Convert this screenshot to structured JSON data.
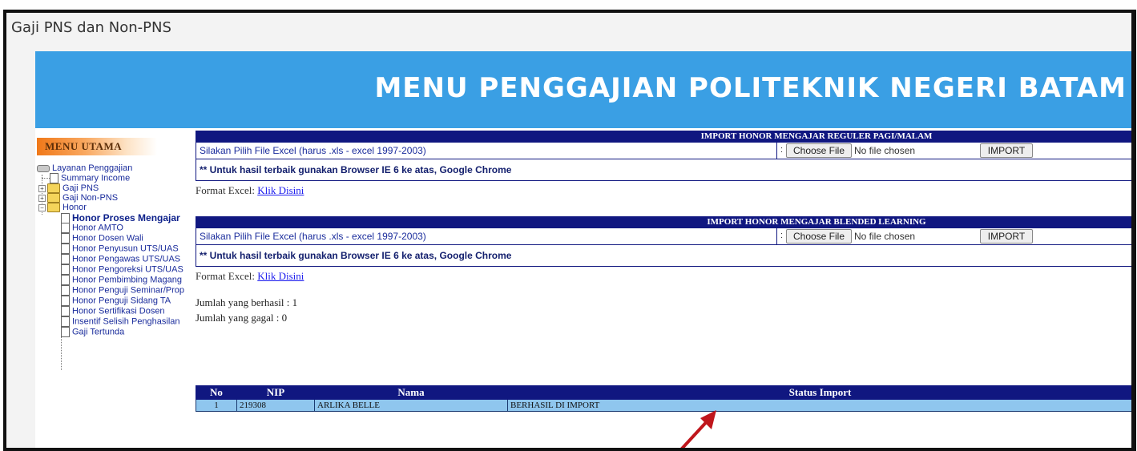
{
  "window": {
    "title": "Gaji PNS dan Non-PNS"
  },
  "banner": {
    "title": "MENU PENGGAJIAN POLITEKNIK NEGERI BATAM"
  },
  "sidebar": {
    "header": "MENU UTAMA",
    "items": [
      {
        "label": "Layanan Penggajian"
      },
      {
        "label": "Summary Income"
      },
      {
        "label": "Gaji PNS"
      },
      {
        "label": "Gaji Non-PNS"
      },
      {
        "label": "Honor"
      },
      {
        "label": "Honor Proses Mengajar"
      },
      {
        "label": "Honor AMTO"
      },
      {
        "label": "Honor Dosen Wali"
      },
      {
        "label": "Honor Penyusun UTS/UAS"
      },
      {
        "label": "Honor Pengawas UTS/UAS"
      },
      {
        "label": "Honor Pengoreksi UTS/UAS"
      },
      {
        "label": "Honor Pembimbing Magang"
      },
      {
        "label": "Honor Penguji Seminar/Prop"
      },
      {
        "label": "Honor Penguji Sidang TA"
      },
      {
        "label": "Honor Sertifikasi Dosen"
      },
      {
        "label": "Insentif Selisih Penghasilan"
      },
      {
        "label": "Gaji Tertunda"
      }
    ]
  },
  "sections": [
    {
      "title": "IMPORT HONOR MENGAJAR REGULER PAGI/MALAM",
      "file_label": "Silakan Pilih File Excel (harus .xls - excel 1997-2003)",
      "choose_label": "Choose File",
      "no_file": "No file chosen",
      "import_label": "IMPORT",
      "note": "** Untuk hasil terbaik gunakan Browser IE 6 ke atas, Google Chrome",
      "format_label": "Format Excel:",
      "format_link": "Klik Disini"
    },
    {
      "title": "IMPORT HONOR MENGAJAR BLENDED LEARNING",
      "file_label": "Silakan Pilih File Excel (harus .xls - excel 1997-2003)",
      "choose_label": "Choose File",
      "no_file": "No file chosen",
      "import_label": "IMPORT",
      "note": "** Untuk hasil terbaik gunakan Browser IE 6 ke atas, Google Chrome",
      "format_label": "Format Excel:",
      "format_link": "Klik Disini"
    }
  ],
  "summary": {
    "success": "Jumlah yang berhasil : 1",
    "failed": "Jumlah yang gagal : 0"
  },
  "result_table": {
    "headers": [
      "No",
      "NIP",
      "Nama",
      "Status Import"
    ],
    "rows": [
      [
        "1",
        "219308",
        "ARLIKA BELLE",
        "BERHASIL DI IMPORT"
      ]
    ]
  },
  "colors": {
    "banner": "#3a9fe4",
    "header_navy": "#101780",
    "row_blue": "#8fc6ee",
    "arrow": "#c0161c"
  }
}
